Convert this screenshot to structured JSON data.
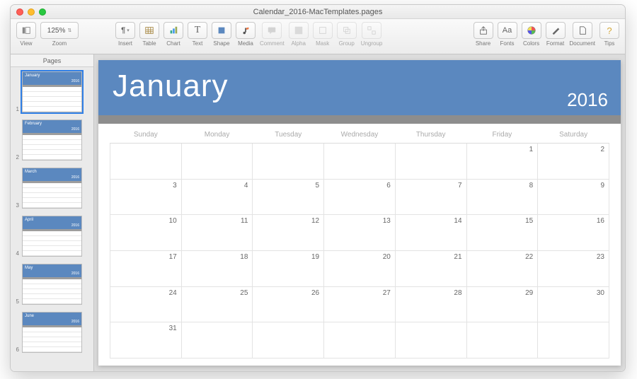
{
  "window": {
    "title": "Calendar_2016-MacTemplates.pages"
  },
  "toolbar": {
    "view_label": "View",
    "zoom_value": "125%",
    "zoom_label": "Zoom",
    "insert_label": "Insert",
    "table_label": "Table",
    "chart_label": "Chart",
    "text_label": "Text",
    "shape_label": "Shape",
    "media_label": "Media",
    "comment_label": "Comment",
    "alpha_label": "Alpha",
    "mask_label": "Mask",
    "group_label": "Group",
    "ungroup_label": "Ungroup",
    "share_label": "Share",
    "fonts_label": "Fonts",
    "colors_label": "Colors",
    "format_label": "Format",
    "document_label": "Document",
    "tips_label": "Tips"
  },
  "sidebar": {
    "header": "Pages",
    "thumbs": [
      {
        "num": "1",
        "month": "January",
        "year": "2016"
      },
      {
        "num": "2",
        "month": "February",
        "year": "2016"
      },
      {
        "num": "3",
        "month": "March",
        "year": "2016"
      },
      {
        "num": "4",
        "month": "April",
        "year": "2016"
      },
      {
        "num": "5",
        "month": "May",
        "year": "2016"
      },
      {
        "num": "6",
        "month": "June",
        "year": "2016"
      }
    ]
  },
  "calendar": {
    "month": "January",
    "year": "2016",
    "day_headers": [
      "Sunday",
      "Monday",
      "Tuesday",
      "Wednesday",
      "Thursday",
      "Friday",
      "Saturday"
    ],
    "rows": [
      [
        "",
        "",
        "",
        "",
        "",
        "1",
        "2"
      ],
      [
        "3",
        "4",
        "5",
        "6",
        "7",
        "8",
        "9"
      ],
      [
        "10",
        "11",
        "12",
        "13",
        "14",
        "15",
        "16"
      ],
      [
        "17",
        "18",
        "19",
        "20",
        "21",
        "22",
        "23"
      ],
      [
        "24",
        "25",
        "26",
        "27",
        "28",
        "29",
        "30"
      ],
      [
        "31",
        "",
        "",
        "",
        "",
        "",
        ""
      ]
    ]
  },
  "colors": {
    "accent": "#5b88bf",
    "strip": "#8d8d8d"
  }
}
